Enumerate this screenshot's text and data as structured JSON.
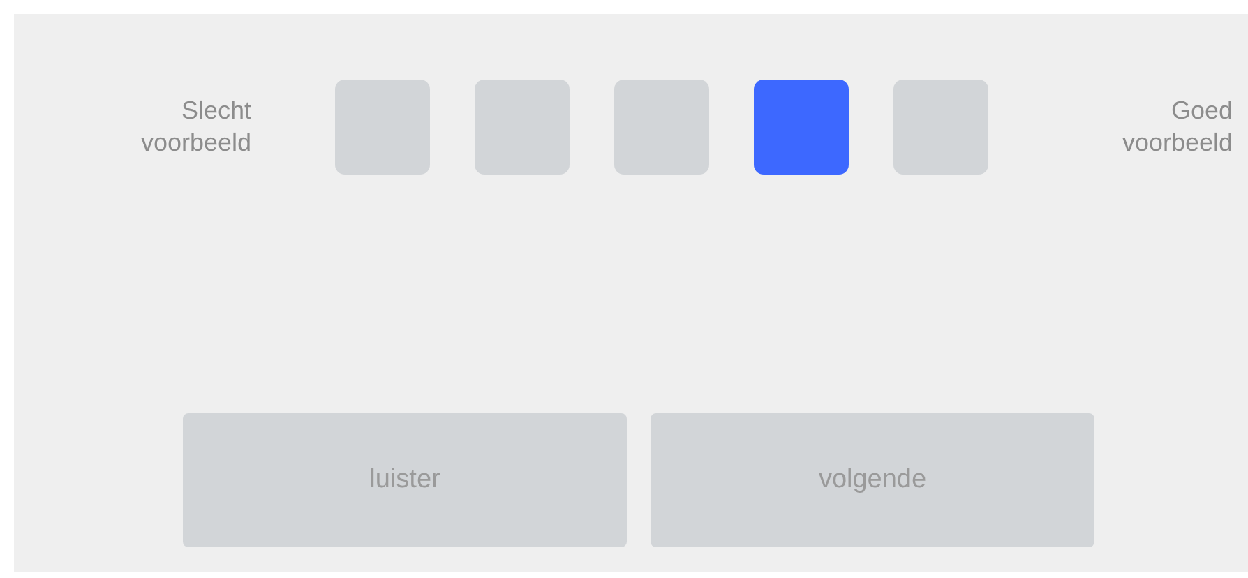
{
  "scale": {
    "low_label": "Slecht voorbeeld",
    "high_label": "Goed voorbeeld",
    "options": [
      {
        "selected": false
      },
      {
        "selected": false
      },
      {
        "selected": false
      },
      {
        "selected": true
      },
      {
        "selected": false
      }
    ]
  },
  "buttons": [
    "luister",
    "volgende"
  ]
}
